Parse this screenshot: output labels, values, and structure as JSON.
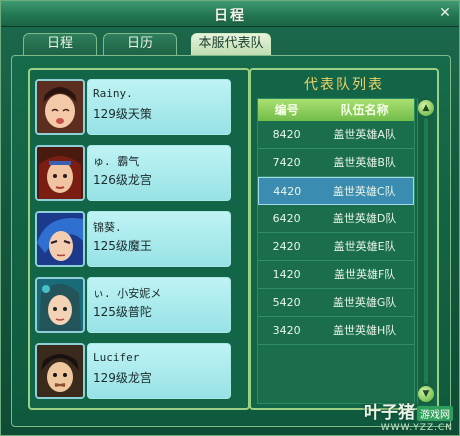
{
  "window": {
    "title": "日程",
    "close_icon": "close-icon"
  },
  "tabs": [
    {
      "label": "日程",
      "active": false
    },
    {
      "label": "日历",
      "active": false
    },
    {
      "label": "本服代表队",
      "active": true
    }
  ],
  "members": [
    {
      "name": "Rainy.",
      "level": "129级天策"
    },
    {
      "name": "ゅ. 霸气",
      "level": "126级龙宫"
    },
    {
      "name": "锦葵.",
      "level": "125级魔王"
    },
    {
      "name": "ぃ. 小安妮メ",
      "level": "125级普陀"
    },
    {
      "name": "Lucifer",
      "level": "129级龙宫"
    }
  ],
  "team_list": {
    "title": "代表队列表",
    "columns": [
      "编号",
      "队伍名称"
    ],
    "rows": [
      {
        "id": "8420",
        "name": "盖世英雄A队",
        "selected": false
      },
      {
        "id": "7420",
        "name": "盖世英雄B队",
        "selected": false
      },
      {
        "id": "4420",
        "name": "盖世英雄C队",
        "selected": true
      },
      {
        "id": "6420",
        "name": "盖世英雄D队",
        "selected": false
      },
      {
        "id": "2420",
        "name": "盖世英雄E队",
        "selected": false
      },
      {
        "id": "1420",
        "name": "盖世英雄F队",
        "selected": false
      },
      {
        "id": "5420",
        "name": "盖世英雄G队",
        "selected": false
      },
      {
        "id": "3420",
        "name": "盖世英雄H队",
        "selected": false
      }
    ]
  },
  "watermark": {
    "main": "叶子猪",
    "badge": "游戏网",
    "url": "WWW.YZZ.CN"
  },
  "colors": {
    "accent_gold": "#f0d36a",
    "selected_row": "#3a8db0",
    "card_bg": "#bff3f4"
  }
}
